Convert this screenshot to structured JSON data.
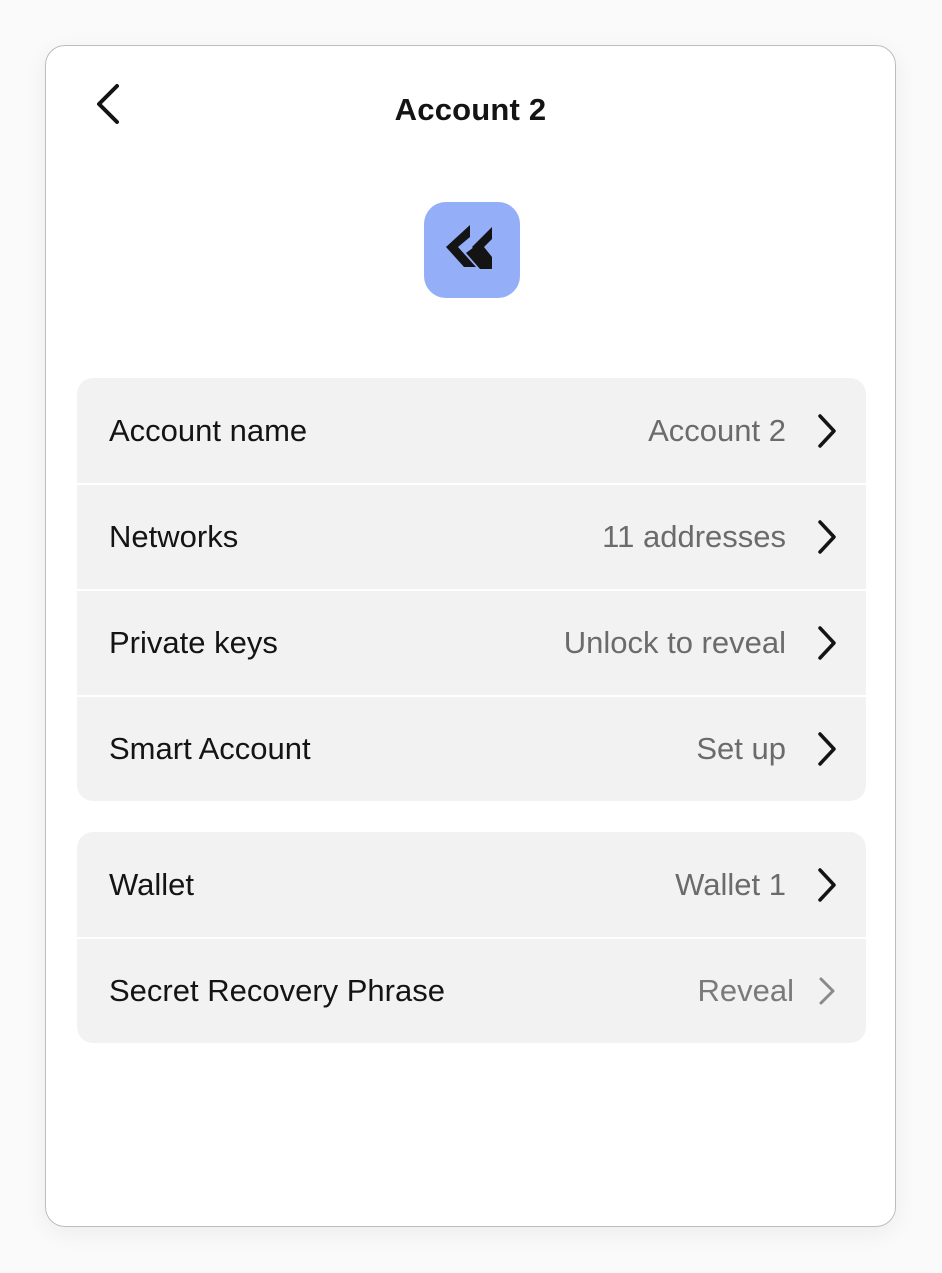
{
  "header": {
    "title": "Account 2",
    "back_icon": "chevron-left-icon"
  },
  "avatar": {
    "icon": "double-arrow-logo-icon",
    "background": "#94aef8"
  },
  "groups": [
    {
      "rows": [
        {
          "label": "Account name",
          "value": "Account 2"
        },
        {
          "label": "Networks",
          "value": "11 addresses"
        },
        {
          "label": "Private keys",
          "value": "Unlock to reveal"
        },
        {
          "label": "Smart Account",
          "value": "Set up"
        }
      ]
    },
    {
      "rows": [
        {
          "label": "Wallet",
          "value": "Wallet 1"
        },
        {
          "label": "Secret Recovery Phrase",
          "value": "Reveal"
        }
      ]
    }
  ],
  "colors": {
    "row_background": "#f2f2f2",
    "label_text": "#141414",
    "value_text": "#6b6b6b"
  }
}
